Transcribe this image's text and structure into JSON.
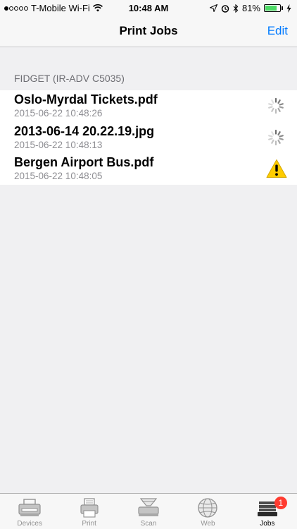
{
  "status_bar": {
    "carrier": "T-Mobile Wi-Fi",
    "time": "10:48 AM",
    "battery_percent": "81%",
    "battery_level": 0.81
  },
  "nav": {
    "title": "Print Jobs",
    "edit_label": "Edit"
  },
  "section": {
    "header": "FIDGET (IR-ADV C5035)"
  },
  "jobs": [
    {
      "name": "Oslo-Myrdal Tickets.pdf",
      "time": "2015-06-22 10:48:26",
      "status_icon": "spinner-icon"
    },
    {
      "name": "2013-06-14 20.22.19.jpg",
      "time": "2015-06-22 10:48:13",
      "status_icon": "spinner-icon"
    },
    {
      "name": "Bergen Airport Bus.pdf",
      "time": "2015-06-22 10:48:05",
      "status_icon": "warning-icon"
    }
  ],
  "tabs": [
    {
      "label": "Devices",
      "icon": "printer-icon"
    },
    {
      "label": "Print",
      "icon": "print-icon"
    },
    {
      "label": "Scan",
      "icon": "scanner-icon"
    },
    {
      "label": "Web",
      "icon": "globe-icon"
    },
    {
      "label": "Jobs",
      "icon": "jobs-icon",
      "badge": "1",
      "active": true
    }
  ],
  "colors": {
    "accent": "#007aff",
    "badge": "#ff3b30",
    "warning": "#ffcc00",
    "battery": "#4cd964"
  }
}
